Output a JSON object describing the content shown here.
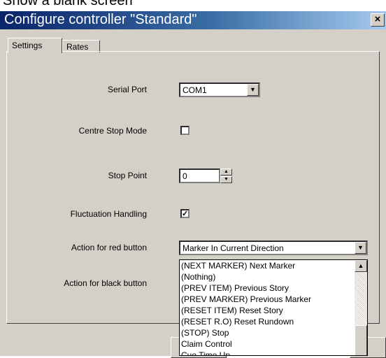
{
  "page_caption": "Show a blank screen",
  "dialog": {
    "title": "Configure controller \"Standard\"",
    "close_glyph": "×"
  },
  "tabs": [
    {
      "label": "Settings"
    },
    {
      "label": "Rates"
    }
  ],
  "settings": {
    "serial_port": {
      "label": "Serial Port",
      "value": "COM1"
    },
    "centre_stop_mode": {
      "label": "Centre Stop Mode",
      "checked": false
    },
    "stop_point": {
      "label": "Stop Point",
      "value": "0"
    },
    "fluctuation_handling": {
      "label": "Fluctuation Handling",
      "checked": true,
      "glyph": "✓"
    },
    "red_button": {
      "label": "Action for red button",
      "value": "Marker In Current Direction"
    },
    "black_button": {
      "label": "Action for black button"
    }
  },
  "dropdown_items": [
    "(NEXT MARKER) Next Marker",
    "(Nothing)",
    "(PREV ITEM) Previous Story",
    "(PREV MARKER) Previous Marker",
    "(RESET ITEM) Reset Story",
    "(RESET R.O) Reset Rundown",
    "(STOP) Stop",
    "Claim Control",
    "Cue Time Up"
  ],
  "icons": {
    "dropdown": "▼",
    "spin_up": "▲",
    "spin_down": "▼",
    "scroll_up": "▲"
  }
}
